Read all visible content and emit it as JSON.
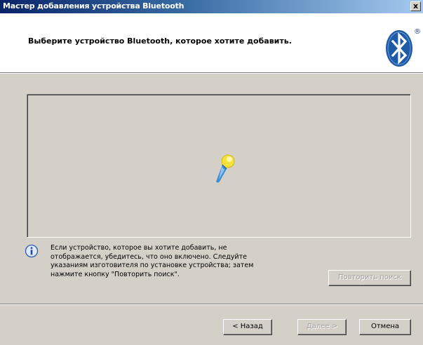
{
  "window": {
    "title": "Мастер добавления устройства Bluetooth",
    "close_label": "x"
  },
  "header": {
    "subtitle": "Выберите устройство Bluetooth, которое хотите добавить.",
    "logo_icon": "bluetooth-icon",
    "registered_mark": "®"
  },
  "search": {
    "animation_icon": "searching-icon"
  },
  "info": {
    "icon": "info-icon",
    "lines": [
      "Если устройство, которое вы хотите добавить, не",
      "отображается, убедитесь, что оно включено. Следуйте",
      "указаниям изготовителя по установке устройства; затем",
      "нажмите кнопку \"Повторить поиск\"."
    ]
  },
  "buttons": {
    "retry_label": "Повторить поиск",
    "back_label": "< Назад",
    "next_label": "Далее >",
    "cancel_label": "Отмена"
  },
  "colors": {
    "titlebar_start": "#0a246a",
    "titlebar_end": "#a6caf0",
    "window_face": "#d4d0c8",
    "bluetooth_blue": "#1f5aa6"
  }
}
